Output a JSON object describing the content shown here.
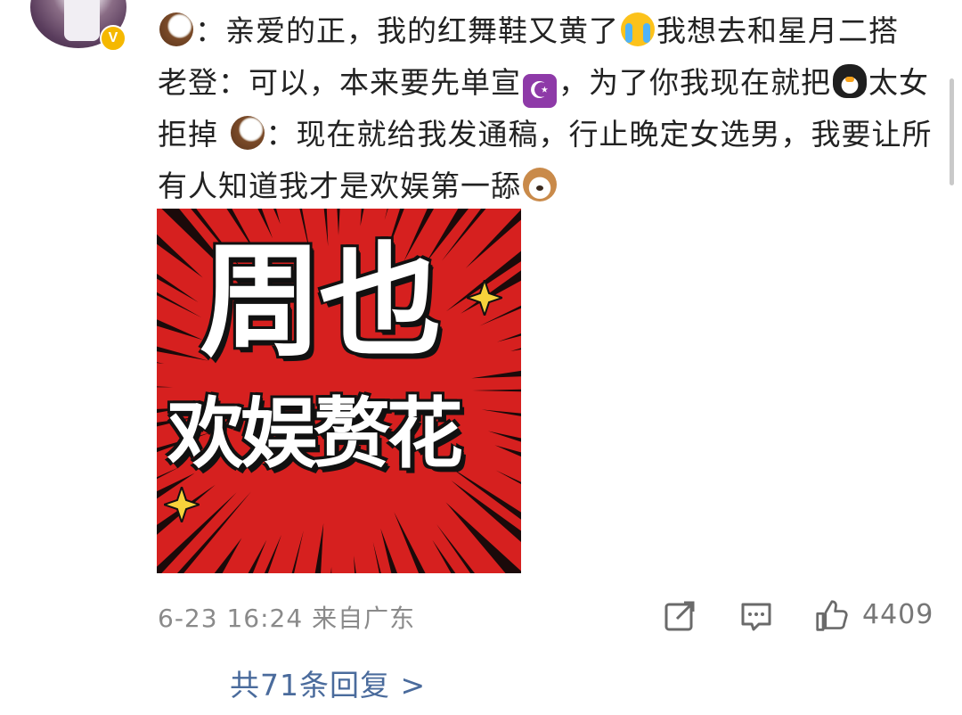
{
  "comment": {
    "avatar_badge": "V",
    "segments": [
      {
        "type": "emoji",
        "icon": "coconut-icon"
      },
      {
        "type": "text",
        "text": "：亲爱的正，我的红舞鞋又黄了"
      },
      {
        "type": "emoji",
        "icon": "crying-face-icon"
      },
      {
        "type": "text",
        "text": "我想去和星月二搭 老登：可以，本来要先单宣"
      },
      {
        "type": "emoji",
        "icon": "star-and-crescent-icon"
      },
      {
        "type": "text",
        "text": "，为了你我现在就把"
      },
      {
        "type": "emoji",
        "icon": "penguin-icon"
      },
      {
        "type": "text",
        "text": "太女拒掉 "
      },
      {
        "type": "emoji",
        "icon": "coconut-icon"
      },
      {
        "type": "text",
        "text": "：现在就给我发通稿，行止晚定女选男，我要让所有人知道我才是欢娱第一舔"
      },
      {
        "type": "emoji",
        "icon": "dog-face-icon"
      }
    ]
  },
  "poster": {
    "line1": "周也",
    "line2": "欢娱赘花",
    "background_color": "#d6201f",
    "ray_color": "#1b0a0a"
  },
  "meta": {
    "date": "6-23",
    "time": "16:24",
    "location": "来自广东",
    "like_count": "4409"
  },
  "replies": {
    "label": "共71条回复 >"
  }
}
